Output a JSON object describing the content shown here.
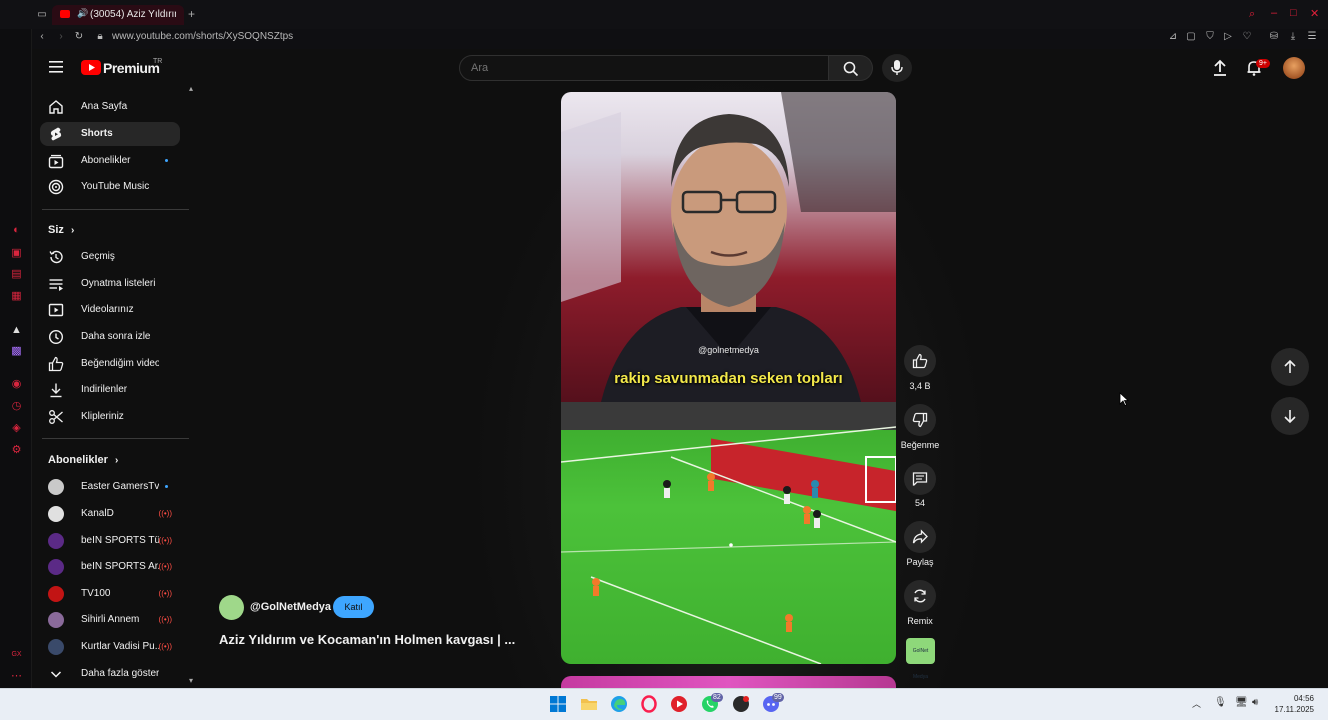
{
  "browser": {
    "tab_title": "(30054) Aziz Yıldırım ve",
    "url": "www.youtube.com/shorts/XySOQNSZtps"
  },
  "header": {
    "logo_text": "Premium",
    "logo_region": "TR",
    "search_placeholder": "Ara",
    "notification_badge": "9+"
  },
  "sidebar": {
    "main": [
      {
        "label": "Ana Sayfa",
        "icon": "home-icon"
      },
      {
        "label": "Shorts",
        "icon": "shorts-icon",
        "active": true
      },
      {
        "label": "Abonelikler",
        "icon": "subscriptions-icon",
        "dot": true
      },
      {
        "label": "YouTube Music",
        "icon": "music-icon"
      }
    ],
    "you_heading": "Siz",
    "you": [
      {
        "label": "Geçmiş",
        "icon": "history-icon"
      },
      {
        "label": "Oynatma listeleri",
        "icon": "playlists-icon"
      },
      {
        "label": "Videolarınız",
        "icon": "your-videos-icon"
      },
      {
        "label": "Daha sonra izle",
        "icon": "watch-later-icon"
      },
      {
        "label": "Beğendiğim videolar",
        "icon": "liked-icon"
      },
      {
        "label": "İndirilenler",
        "icon": "download-icon"
      },
      {
        "label": "Klipleriniz",
        "icon": "clips-icon"
      }
    ],
    "subs_heading": "Abonelikler",
    "subscriptions": [
      {
        "label": "Easter GamersTv",
        "color": "#c9c9c9",
        "status": "dot"
      },
      {
        "label": "KanalD",
        "color": "#e0e0e0",
        "status": "live"
      },
      {
        "label": "beIN SPORTS Tü...",
        "color": "#5b2a86",
        "status": "live"
      },
      {
        "label": "beIN SPORTS Ar...",
        "color": "#5b2a86",
        "status": "live"
      },
      {
        "label": "TV100",
        "color": "#c21414",
        "status": "live"
      },
      {
        "label": "Sihirli Annem",
        "color": "#8a6a9a",
        "status": "live"
      },
      {
        "label": "Kurtlar Vadisi Pu...",
        "color": "#3a4a6a",
        "status": "live"
      }
    ],
    "show_more": "Daha fazla göster"
  },
  "short": {
    "channel": "@GolNetMedya",
    "join_label": "Katıl",
    "title": "Aziz Yıldırım ve Kocaman'ın Holmen kavgası | ...",
    "watermark": "@golnetmedya",
    "caption": "rakip savunmadan seken topları",
    "likes": "3,4 B",
    "dislike_label": "Beğenme",
    "comments": "54",
    "share_label": "Paylaş",
    "remix_label": "Remix",
    "channel_thumb_text": "GolNet Medya"
  },
  "taskbar": {
    "time": "04:56",
    "date": "17.11.2025",
    "badges": [
      "82",
      "99"
    ]
  },
  "colors": {
    "yt_red": "#ff0000",
    "accent_blue": "#3ea6ff",
    "caption_yellow": "#f3e84a",
    "pitch_green": "#4cc23a"
  }
}
